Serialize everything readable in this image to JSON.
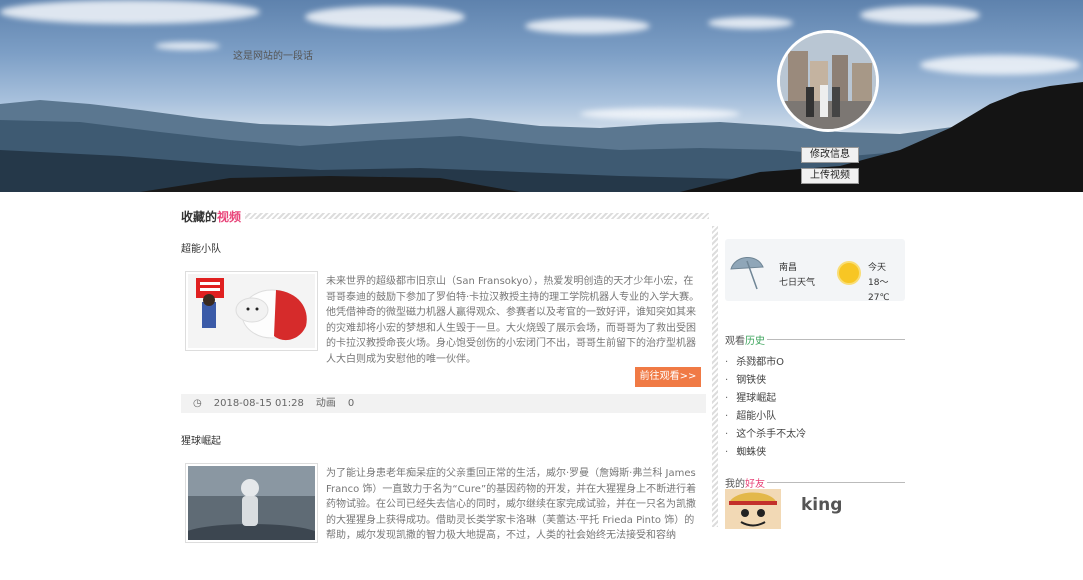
{
  "header": {
    "tagline": "这是网站的一段话",
    "edit_button": "修改信息",
    "upload_button": "上传视频"
  },
  "section": {
    "title_prefix": "收藏的",
    "title_highlight": "视频"
  },
  "videos": [
    {
      "title": "超能小队",
      "description": "未来世界的超级都市旧京山（San Fransokyo），热爱发明创造的天才少年小宏，在哥哥泰迪的鼓励下参加了罗伯特·卡拉汉教授主持的理工学院机器人专业的入学大赛。他凭借神奇的微型磁力机器人赢得观众、参赛者以及考官的一致好评，谁知突如其来的灾难却将小宏的梦想和人生毁于一旦。大火烧毁了展示会场，而哥哥为了救出受困的卡拉汉教授命丧火场。身心饱受创伤的小宏闭门不出，哥哥生前留下的治疗型机器人大白则成为安慰他的唯一伙伴。",
      "watch_label": "前往观看>>",
      "date": "2018-08-15 01:28",
      "category": "动画",
      "count": "0"
    },
    {
      "title": "猩球崛起",
      "description": "为了能让身患老年痴呆症的父亲重回正常的生活，威尔·罗曼（詹姆斯·弗兰科 James Franco 饰）一直致力于名为“Cure”的基因药物的开发，并在大猩猩身上不断进行着药物试验。在公司已经失去信心的同时，威尔继续在家完成试验，并在一只名为凯撒的大猩猩身上获得成功。借助灵长类学家卡洛琳（芙蕾达·平托 Frieda Pinto 饰）的帮助，威尔发现凯撒的智力极大地提高，不过，人类的社会始终无法接受和容纳"
    }
  ],
  "weather": {
    "city": "南昌",
    "forecast": "七日天气",
    "today_label": "今天",
    "temp": "18～27℃"
  },
  "history": {
    "title_prefix": "观看",
    "title_highlight": "历史",
    "items": [
      "杀戮都市O",
      "钢铁侠",
      "猩球崛起",
      "超能小队",
      "这个杀手不太冷",
      "蜘蛛侠"
    ]
  },
  "friends": {
    "title_prefix": "我的",
    "title_highlight": "好友",
    "name": "king"
  },
  "colors": {
    "accent_pink": "#e8457a",
    "watch_button": "#f07a45",
    "history_accent": "#3aa35a"
  }
}
